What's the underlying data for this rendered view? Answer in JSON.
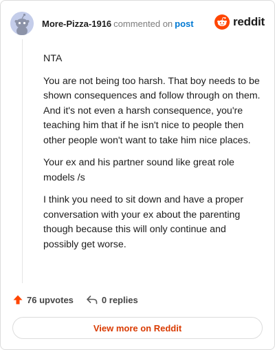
{
  "comment": {
    "username": "More-Pizza-1916",
    "action_text": "commented on",
    "post_link": "post",
    "paragraphs": [
      "NTA",
      "You are not being too harsh. That boy needs to be shown consequences and follow through on them. And it's not even a harsh consequence, you're teaching him that if he isn't nice to people then other people won't want to take him nice places.",
      "Your ex and his partner sound like great role models /s",
      "I think you need to sit down and have a proper conversation with your ex about the parenting though because this will only continue and possibly get worse."
    ]
  },
  "brand": {
    "name": "reddit",
    "color": "#ff4500"
  },
  "actions": {
    "upvotes": "76 upvotes",
    "replies": "0 replies",
    "upvote_icon": "upvote-arrow-icon",
    "reply_icon": "reply-arrow-icon",
    "upvote_color": "#ff4500"
  },
  "footer": {
    "view_more": "View more on Reddit",
    "color": "#d93a00"
  }
}
